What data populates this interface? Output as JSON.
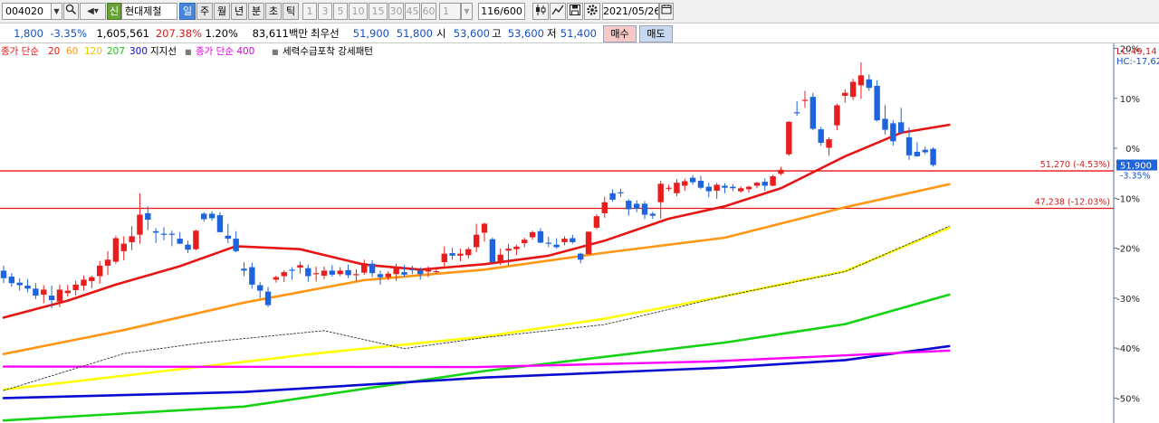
{
  "toolbar": {
    "code": "004020",
    "shin_badge": "신",
    "name": "현대제철",
    "periods": [
      "일",
      "주",
      "월",
      "년",
      "분",
      "초",
      "틱"
    ],
    "selected_period": "일",
    "intervals": [
      "1",
      "3",
      "5",
      "10",
      "15",
      "30",
      "45",
      "60"
    ],
    "custom_interval": "1",
    "count": "116/600",
    "date": "2021/05/26"
  },
  "quote": {
    "change": "1,800",
    "change_pct": "-3.35%",
    "volume": "1,605,561",
    "volume_ratio": "207.38%",
    "turnover_pct": "1.20%",
    "amount": "83,611백만",
    "bid_label": "최우선",
    "ask_price": "51,900",
    "bid_price": "51,800",
    "open_label": "시",
    "open": "53,600",
    "high_label": "고",
    "high": "53,600",
    "low_label": "저",
    "low": "51,400",
    "buy_label": "매수",
    "sell_label": "매도"
  },
  "legend": {
    "ma_label": "종가 단순",
    "ma_periods": [
      "20",
      "60",
      "120",
      "207",
      "300"
    ],
    "support_label": "지지선",
    "ma400_label": "종가 단순 400",
    "pattern_label": "세력수급포착 강세패턴"
  },
  "colors": {
    "up": "#e81e1e",
    "down": "#1e64dc",
    "ma20": "#e81414",
    "ma60": "#ff9614",
    "ma120": "#ffff00",
    "ma207": "#14d214",
    "ma300": "#0a0ad2",
    "ma400": "#ff00ff",
    "support": "#e81414",
    "pattern": "#333333"
  },
  "chart_data": {
    "type": "candlestick",
    "y_unit": "% of current price",
    "ylim": [
      -55,
      21
    ],
    "y_ticks": [
      20,
      10,
      0,
      -10,
      -20,
      -30,
      -40,
      -50
    ],
    "y_tick_labels": [
      "20%",
      "10%",
      "0%",
      "-10%",
      "-20%",
      "-30%",
      "-40%",
      "-50%"
    ],
    "corner_labels": [
      "LC:49,14",
      "HC:-17,62"
    ],
    "current_price": {
      "price": "51,900",
      "pct": "-3.35%",
      "value": -3.35
    },
    "support_lines": [
      {
        "label": "51,270 (-4.53%)",
        "value": -4.53
      },
      {
        "label": "47,238 (-12.03%)",
        "value": -12.03
      }
    ],
    "candles": [
      {
        "o": -24.5,
        "h": -23.5,
        "l": -27,
        "c": -26
      },
      {
        "o": -25.7,
        "h": -25,
        "l": -27.7,
        "c": -27
      },
      {
        "o": -26.9,
        "h": -26,
        "l": -28.5,
        "c": -27.4
      },
      {
        "o": -27.5,
        "h": -26.2,
        "l": -28.8,
        "c": -28.1
      },
      {
        "o": -28.1,
        "h": -27,
        "l": -30.2,
        "c": -29.5
      },
      {
        "o": -29.3,
        "h": -27.4,
        "l": -31,
        "c": -28.3
      },
      {
        "o": -29.5,
        "h": -27.5,
        "l": -32,
        "c": -30.4
      },
      {
        "o": -30.7,
        "h": -27.3,
        "l": -31.8,
        "c": -28.3
      },
      {
        "o": -29,
        "h": -27.3,
        "l": -29.7,
        "c": -28.5
      },
      {
        "o": -28.4,
        "h": -26.5,
        "l": -29.5,
        "c": -27.3
      },
      {
        "o": -27.5,
        "h": -25.5,
        "l": -28.5,
        "c": -26.3
      },
      {
        "o": -26.6,
        "h": -25.5,
        "l": -28,
        "c": -25.8
      },
      {
        "o": -25.6,
        "h": -22.6,
        "l": -27.1,
        "c": -23.5
      },
      {
        "o": -23.5,
        "h": -20.6,
        "l": -25.4,
        "c": -22.3
      },
      {
        "o": -22.7,
        "h": -17.5,
        "l": -23.1,
        "c": -18
      },
      {
        "o": -20.6,
        "h": -17.6,
        "l": -22.4,
        "c": -19.1
      },
      {
        "o": -18.8,
        "h": -15.6,
        "l": -20.4,
        "c": -17.6
      },
      {
        "o": -17.3,
        "h": -9,
        "l": -19.1,
        "c": -13.3
      },
      {
        "o": -13,
        "h": -11.6,
        "l": -16.4,
        "c": -14.3
      },
      {
        "o": -16.6,
        "h": -16,
        "l": -19,
        "c": -16.9
      },
      {
        "o": -17.1,
        "h": -15.8,
        "l": -18.4,
        "c": -17.3
      },
      {
        "o": -17.1,
        "h": -16.5,
        "l": -19.6,
        "c": -17.3
      },
      {
        "o": -18.1,
        "h": -16.8,
        "l": -19.2,
        "c": -19.1
      },
      {
        "o": -19.3,
        "h": -18.5,
        "l": -21,
        "c": -20.3
      },
      {
        "o": -20.2,
        "h": -16.3,
        "l": -20.4,
        "c": -16.5
      },
      {
        "o": -13.1,
        "h": -12.8,
        "l": -14.7,
        "c": -14.2
      },
      {
        "o": -13.1,
        "h": -12.6,
        "l": -14.5,
        "c": -14
      },
      {
        "o": -13.4,
        "h": -12.8,
        "l": -16.8,
        "c": -16.8
      },
      {
        "o": -17.5,
        "h": -15.1,
        "l": -19,
        "c": -18.1
      },
      {
        "o": -18.1,
        "h": -16.6,
        "l": -20.8,
        "c": -20.6
      },
      {
        "o": -24.1,
        "h": -22.8,
        "l": -25.6,
        "c": -24.5
      },
      {
        "o": -23.8,
        "h": -22.9,
        "l": -28.1,
        "c": -27.3
      },
      {
        "o": -27.4,
        "h": -26.8,
        "l": -30,
        "c": -28.5
      },
      {
        "o": -28.7,
        "h": -27.8,
        "l": -31.8,
        "c": -31.4
      },
      {
        "o": -26.3,
        "h": -25.5,
        "l": -26.9,
        "c": -25.8
      },
      {
        "o": -25.6,
        "h": -24.4,
        "l": -26.8,
        "c": -24.8
      },
      {
        "o": -24.3,
        "h": -23.8,
        "l": -26.3,
        "c": -24.5
      },
      {
        "o": -23.9,
        "h": -22.7,
        "l": -25.1,
        "c": -23.4
      },
      {
        "o": -24,
        "h": -23.3,
        "l": -26.7,
        "c": -25.6
      },
      {
        "o": -25,
        "h": -23.7,
        "l": -26.7,
        "c": -25
      },
      {
        "o": -25.5,
        "h": -23.7,
        "l": -26.2,
        "c": -24.5
      },
      {
        "o": -24.5,
        "h": -23.4,
        "l": -25.7,
        "c": -25.3
      },
      {
        "o": -25.2,
        "h": -23.8,
        "l": -25.6,
        "c": -24.5
      },
      {
        "o": -24.4,
        "h": -23.3,
        "l": -26,
        "c": -25.4
      },
      {
        "o": -25.2,
        "h": -24.2,
        "l": -26.6,
        "c": -25.2
      },
      {
        "o": -24.9,
        "h": -22.3,
        "l": -25.3,
        "c": -23
      },
      {
        "o": -23.1,
        "h": -22.4,
        "l": -25.8,
        "c": -25
      },
      {
        "o": -25.2,
        "h": -24.5,
        "l": -27.3,
        "c": -25.8
      },
      {
        "o": -25.8,
        "h": -24.6,
        "l": -26.4,
        "c": -25.1
      },
      {
        "o": -25.2,
        "h": -23.1,
        "l": -26.6,
        "c": -23.8
      },
      {
        "o": -24.8,
        "h": -23.4,
        "l": -25.7,
        "c": -25.3
      },
      {
        "o": -24.2,
        "h": -23.5,
        "l": -25.2,
        "c": -24.4
      },
      {
        "o": -24.5,
        "h": -23.8,
        "l": -26.3,
        "c": -25.2
      },
      {
        "o": -24.7,
        "h": -23.6,
        "l": -25.8,
        "c": -24
      },
      {
        "o": -24.8,
        "h": -23.9,
        "l": -25.1,
        "c": -24.6
      },
      {
        "o": -22.8,
        "h": -19.7,
        "l": -23.9,
        "c": -21.1
      },
      {
        "o": -21,
        "h": -19.9,
        "l": -22.3,
        "c": -21.5
      },
      {
        "o": -21.5,
        "h": -20.1,
        "l": -22.6,
        "c": -21.1
      },
      {
        "o": -21.4,
        "h": -19.8,
        "l": -22.1,
        "c": -20.2
      },
      {
        "o": -19.8,
        "h": -15.1,
        "l": -20.8,
        "c": -17.3
      },
      {
        "o": -16.9,
        "h": -14.9,
        "l": -18.7,
        "c": -15.1
      },
      {
        "o": -18.2,
        "h": -17.9,
        "l": -23,
        "c": -22.8
      },
      {
        "o": -22.8,
        "h": -20.1,
        "l": -23.4,
        "c": -21.3
      },
      {
        "o": -20.5,
        "h": -19.1,
        "l": -23.4,
        "c": -20.1
      },
      {
        "o": -20.2,
        "h": -19.3,
        "l": -21.4,
        "c": -19.7
      },
      {
        "o": -19,
        "h": -17.9,
        "l": -19.8,
        "c": -18.3
      },
      {
        "o": -17.8,
        "h": -16.5,
        "l": -18.3,
        "c": -16.8
      },
      {
        "o": -16.6,
        "h": -16,
        "l": -19,
        "c": -18.9
      },
      {
        "o": -18.9,
        "h": -17.7,
        "l": -19.8,
        "c": -19.1
      },
      {
        "o": -19.3,
        "h": -18,
        "l": -20.1,
        "c": -19.8
      },
      {
        "o": -18.8,
        "h": -17.6,
        "l": -19.4,
        "c": -18.1
      },
      {
        "o": -18,
        "h": -17.3,
        "l": -19.1,
        "c": -18.8
      },
      {
        "o": -21.1,
        "h": -20.9,
        "l": -23,
        "c": -22.3
      },
      {
        "o": -21.2,
        "h": -16.6,
        "l": -21.2,
        "c": -16.7
      },
      {
        "o": -15.9,
        "h": -13.2,
        "l": -16.2,
        "c": -13.6
      },
      {
        "o": -13,
        "h": -9.7,
        "l": -13.9,
        "c": -10.8
      },
      {
        "o": -9,
        "h": -8.2,
        "l": -10.7,
        "c": -10.3
      },
      {
        "o": -8.8,
        "h": -8.1,
        "l": -9.7,
        "c": -9
      },
      {
        "o": -10.5,
        "h": -10.2,
        "l": -13.5,
        "c": -12.2
      },
      {
        "o": -11.1,
        "h": -10.4,
        "l": -12.8,
        "c": -12.1
      },
      {
        "o": -11.1,
        "h": -10.6,
        "l": -14.2,
        "c": -13.3
      },
      {
        "o": -13.1,
        "h": -12.7,
        "l": -14.1,
        "c": -13.5
      },
      {
        "o": -10.8,
        "h": -6.5,
        "l": -14.1,
        "c": -7.1
      },
      {
        "o": -7.9,
        "h": -7.3,
        "l": -8.6,
        "c": -7.9
      },
      {
        "o": -9,
        "h": -6.2,
        "l": -9.6,
        "c": -6.9
      },
      {
        "o": -7.5,
        "h": -6.1,
        "l": -8.5,
        "c": -6.6
      },
      {
        "o": -5.9,
        "h": -5.4,
        "l": -7.3,
        "c": -6.8
      },
      {
        "o": -6.5,
        "h": -5.5,
        "l": -8.2,
        "c": -7.9
      },
      {
        "o": -7.7,
        "h": -6.9,
        "l": -9.8,
        "c": -8.6
      },
      {
        "o": -8.5,
        "h": -6.9,
        "l": -10.1,
        "c": -7.3
      },
      {
        "o": -7.5,
        "h": -7,
        "l": -9,
        "c": -7.9
      },
      {
        "o": -7.7,
        "h": -7.2,
        "l": -8.6,
        "c": -8
      },
      {
        "o": -8.6,
        "h": -7.6,
        "l": -8.9,
        "c": -8
      },
      {
        "o": -8.2,
        "h": -7.5,
        "l": -8.9,
        "c": -7.7
      },
      {
        "o": -7.5,
        "h": -6.7,
        "l": -8,
        "c": -6.9
      },
      {
        "o": -6.7,
        "h": -6,
        "l": -8.5,
        "c": -7.5
      },
      {
        "o": -7.5,
        "h": -5.3,
        "l": -7.6,
        "c": -5.6
      },
      {
        "o": -5.1,
        "h": -3.7,
        "l": -5.4,
        "c": -4.3
      },
      {
        "o": -1.2,
        "h": 5.4,
        "l": -1.5,
        "c": 5.3
      },
      {
        "o": 7.2,
        "h": 9.4,
        "l": 6.5,
        "c": 7.1
      },
      {
        "o": 9.5,
        "h": 11.5,
        "l": 8.1,
        "c": 9.7
      },
      {
        "o": 10.3,
        "h": 11.1,
        "l": 3.6,
        "c": 3.9
      },
      {
        "o": 3.8,
        "h": 4.3,
        "l": 0.5,
        "c": 1.1
      },
      {
        "o": 0.1,
        "h": 2.2,
        "l": -1.5,
        "c": 1.8
      },
      {
        "o": 4.6,
        "h": 8.9,
        "l": 3.6,
        "c": 8.6
      },
      {
        "o": 10.5,
        "h": 11.8,
        "l": 9.1,
        "c": 11.1
      },
      {
        "o": 10.3,
        "h": 13.9,
        "l": 9.7,
        "c": 13.3
      },
      {
        "o": 12.6,
        "h": 17.2,
        "l": 9.9,
        "c": 14.6
      },
      {
        "o": 13.8,
        "h": 14.8,
        "l": 11.5,
        "c": 12.1
      },
      {
        "o": 12.5,
        "h": 13.6,
        "l": 5.4,
        "c": 5.6
      },
      {
        "o": 5.9,
        "h": 8.6,
        "l": 2.8,
        "c": 3.7
      },
      {
        "o": 5,
        "h": 5.6,
        "l": 0.5,
        "c": 1.4
      },
      {
        "o": 5.2,
        "h": 8.1,
        "l": 3,
        "c": 3.1
      },
      {
        "o": 2.2,
        "h": 4.2,
        "l": -2.3,
        "c": -1.4
      },
      {
        "o": -0.7,
        "h": 1.2,
        "l": -1.7,
        "c": -1.6
      },
      {
        "o": -0.3,
        "h": 0.3,
        "l": -1.2,
        "c": -0.8
      },
      {
        "o": -0.1,
        "h": 0.2,
        "l": -3.7,
        "c": -3.35
      }
    ],
    "moving_averages": [
      {
        "period": "20",
        "values": [
          [
            0,
            -33.9
          ],
          [
            8,
            -30.5
          ],
          [
            14,
            -27.3
          ],
          [
            22,
            -23.6
          ],
          [
            29,
            -19.6
          ],
          [
            37,
            -20.2
          ],
          [
            45,
            -23.3
          ],
          [
            52,
            -24.3
          ],
          [
            60,
            -23.2
          ],
          [
            68,
            -21.5
          ],
          [
            75,
            -18.5
          ],
          [
            83,
            -14.1
          ],
          [
            90,
            -11.6
          ],
          [
            97,
            -8.0
          ],
          [
            105,
            -1.6
          ],
          [
            112,
            3.1
          ],
          [
            118,
            4.7
          ]
        ]
      },
      {
        "period": "60",
        "values": [
          [
            0,
            -41.2
          ],
          [
            15,
            -36.4
          ],
          [
            30,
            -30.9
          ],
          [
            45,
            -26.4
          ],
          [
            60,
            -24.3
          ],
          [
            75,
            -20.9
          ],
          [
            90,
            -17.9
          ],
          [
            105,
            -11.8
          ],
          [
            118,
            -7.2
          ]
        ]
      },
      {
        "period": "120",
        "values": [
          [
            0,
            -48.3
          ],
          [
            20,
            -44.6
          ],
          [
            40,
            -40.9
          ],
          [
            60,
            -37.7
          ],
          [
            75,
            -34.1
          ],
          [
            90,
            -29.6
          ],
          [
            105,
            -24.6
          ],
          [
            118,
            -15.9
          ]
        ]
      },
      {
        "period": "207",
        "values": [
          [
            0,
            -54.5
          ],
          [
            30,
            -51.7
          ],
          [
            60,
            -44.6
          ],
          [
            90,
            -38.9
          ],
          [
            105,
            -35.2
          ],
          [
            118,
            -29.3
          ]
        ]
      },
      {
        "period": "300",
        "values": [
          [
            0,
            -50.0
          ],
          [
            30,
            -48.8
          ],
          [
            60,
            -45.9
          ],
          [
            90,
            -43.9
          ],
          [
            105,
            -42.4
          ],
          [
            118,
            -39.6
          ]
        ]
      },
      {
        "period": "400",
        "values": [
          [
            0,
            -43.7
          ],
          [
            59,
            -43.8
          ],
          [
            88,
            -42.7
          ],
          [
            118,
            -40.5
          ]
        ]
      },
      {
        "period": "pattern",
        "values": [
          [
            0,
            -48.5
          ],
          [
            15,
            -41.1
          ],
          [
            25,
            -38.9
          ],
          [
            40,
            -36.5
          ],
          [
            50,
            -40.1
          ],
          [
            60,
            -37.9
          ],
          [
            75,
            -35.3
          ],
          [
            90,
            -29.6
          ],
          [
            105,
            -24.7
          ],
          [
            118,
            -15.6
          ]
        ]
      }
    ]
  }
}
